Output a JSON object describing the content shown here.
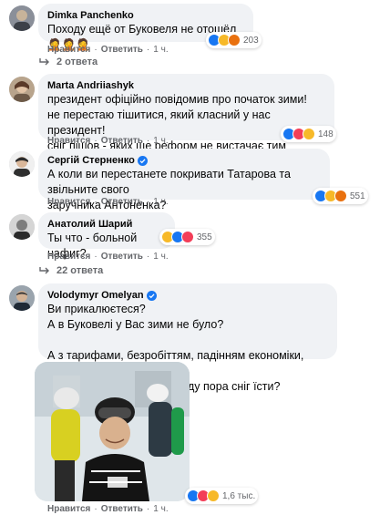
{
  "comments": [
    {
      "author": "Dimka Panchenko",
      "text": "Походу ещё от Буковеля не отошёл 🤦🤦🤦",
      "actions": {
        "like": "Нравится",
        "reply": "Ответить",
        "time": "1 ч."
      },
      "reactions": {
        "count": "203",
        "icons": [
          "like-reaction-icon",
          "haha-reaction-icon",
          "angry-reaction-icon"
        ]
      },
      "replies": "2 ответа"
    },
    {
      "author": "Marta Andriiashyk",
      "text": "президент офіційно повідомив про початок зими!\nне перестаю тішитися, який класний у нас президент!\nсніг пішов - яких ще реформ не вистачає тим парахаботікам!",
      "actions": {
        "like": "Нравится",
        "reply": "Ответить",
        "time": "1 ч."
      },
      "reactions": {
        "count": "148",
        "icons": [
          "like-reaction-icon",
          "love-reaction-icon",
          "haha-reaction-icon"
        ]
      }
    },
    {
      "author": "Сергій Стерненко",
      "text": "А коли ви перестанете покривати Татарова та звільните свого\nзаручника Антоненка?",
      "actions": {
        "like": "Нравится",
        "reply": "Ответить",
        "time": "1 ч."
      },
      "reactions": {
        "count": "551",
        "icons": [
          "like-reaction-icon",
          "haha-reaction-icon",
          "angry-reaction-icon"
        ]
      }
    },
    {
      "author": "Анатолий Шарий",
      "text": "Ты что - больной нафиг?",
      "actions": {
        "like": "Нравится",
        "reply": "Ответить",
        "time": "1 ч."
      },
      "reactions": {
        "count": "355",
        "icons": [
          "haha-reaction-icon",
          "like-reaction-icon",
          "love-reaction-icon"
        ]
      },
      "replies": "22 ответа"
    },
    {
      "author": "Volodymyr Omelyan",
      "text": "Ви прикалюєтеся?\nА в Буковелі у Вас зими не було?\n\nА з тарифами, безробіттям, падінням економіки, вакцинацією щось\nплануєте робити? Чи народу пора сніг їсти?",
      "actions": {
        "like": "Нравится",
        "reply": "Ответить",
        "time": "1 ч."
      },
      "reactions": {
        "count": "1,6 тыс.",
        "icons": [
          "like-reaction-icon",
          "love-reaction-icon",
          "haha-reaction-icon"
        ]
      }
    }
  ],
  "colors": {
    "bubble": "#f0f2f5",
    "meta": "#65676b",
    "like": "#1877f2",
    "love": "#f33e58",
    "haha": "#f7b928",
    "angry": "#e9710f",
    "verified": "#1877f2"
  }
}
